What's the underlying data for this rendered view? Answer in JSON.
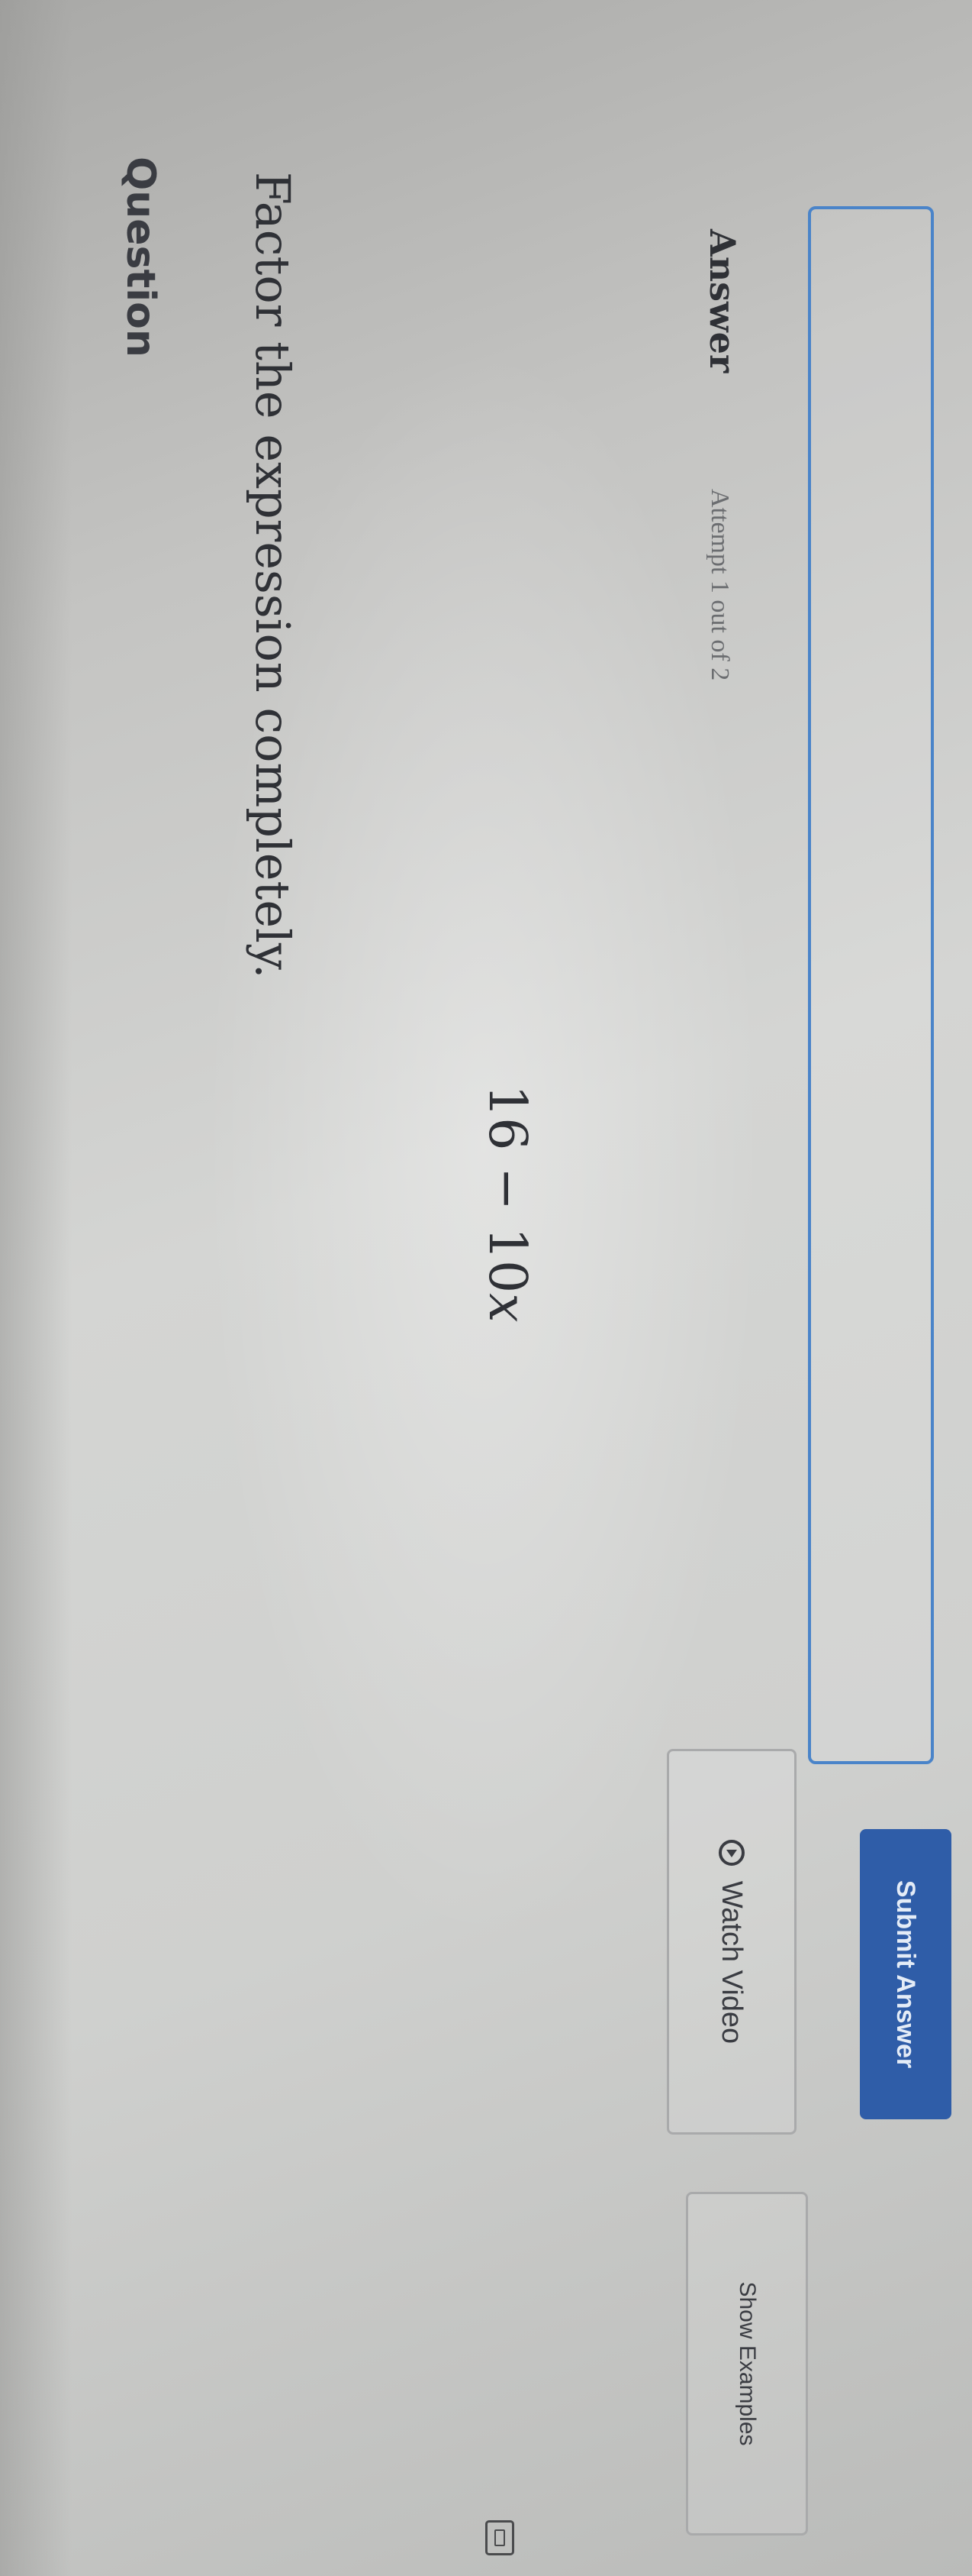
{
  "question": {
    "label": "Question",
    "prompt": "Factor the expression completely.",
    "expression": {
      "prefix": "16 − 10",
      "variable": "x"
    }
  },
  "answer": {
    "label": "Answer",
    "attempt_text": "Attempt 1 out of 2",
    "input_value": ""
  },
  "actions": {
    "watch_video": "Watch Video",
    "show_examples": "Show Examples",
    "submit": "Submit Answer"
  },
  "icons": {
    "watch_video": "play-circle-icon",
    "feedback": "feedback-icon"
  },
  "colors": {
    "submit_button": "#2f5da8",
    "answer_field_border": "#4a84c9"
  }
}
